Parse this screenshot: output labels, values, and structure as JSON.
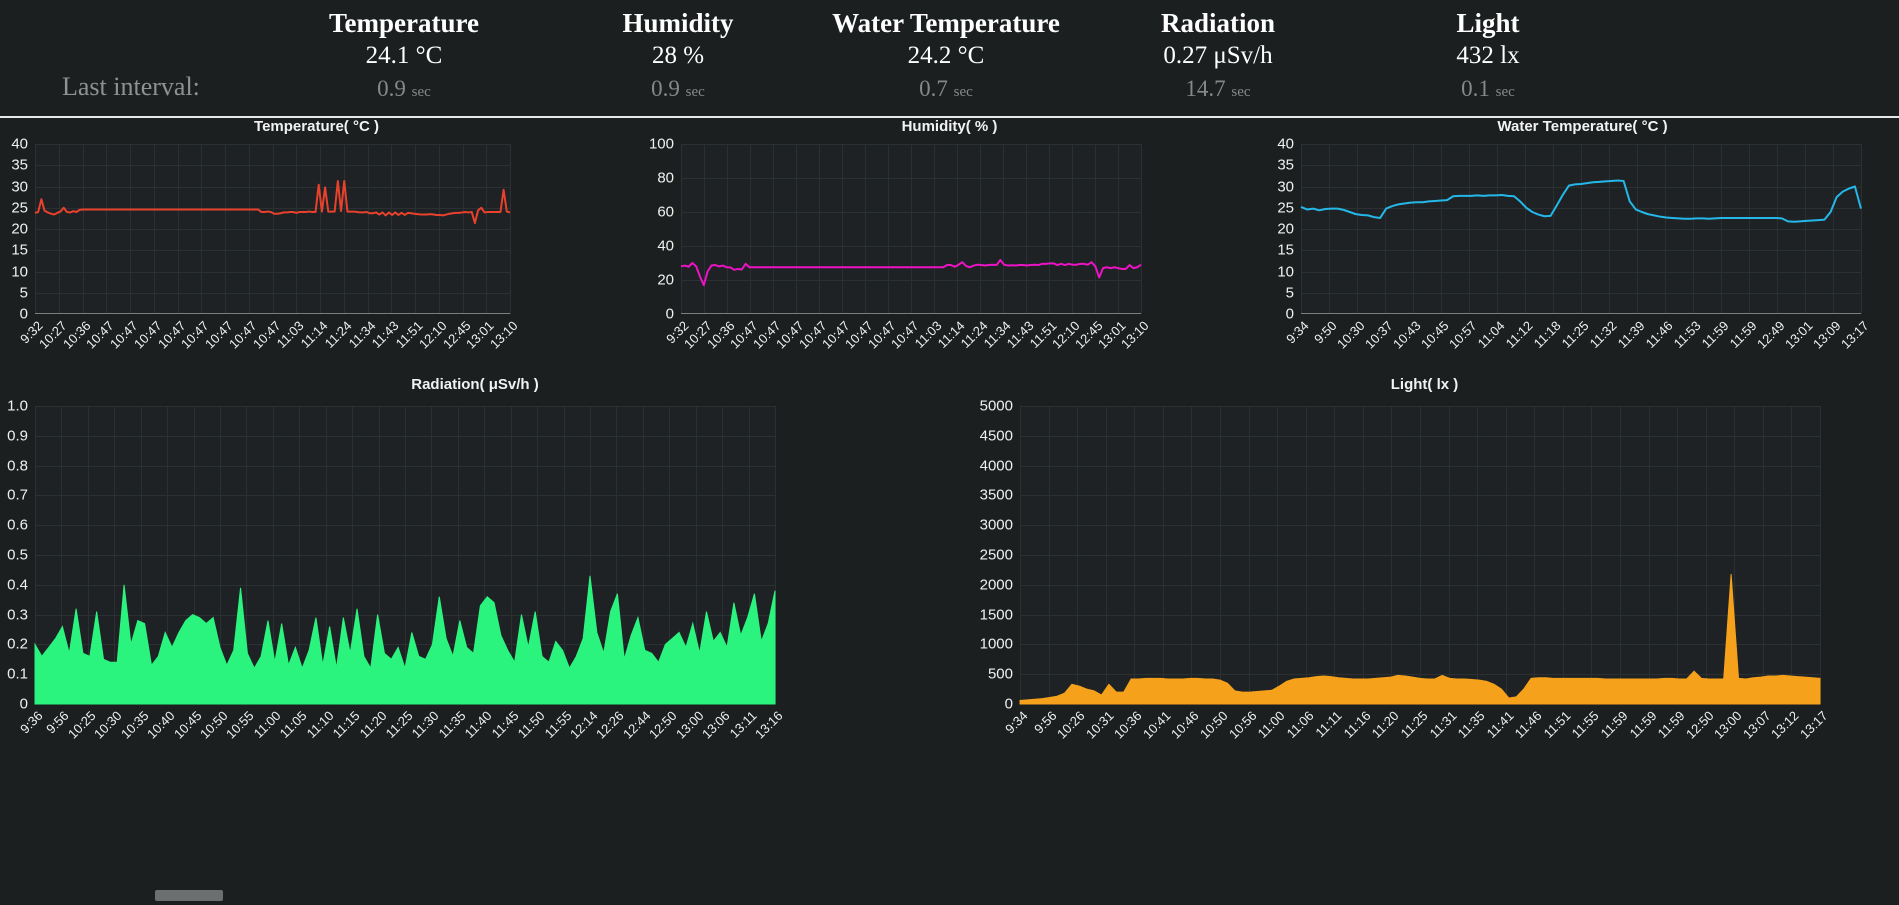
{
  "header": {
    "interval_label": "Last interval:",
    "metrics": [
      {
        "name": "Temperature",
        "value": "24.1 °C",
        "interval": "0.9",
        "interval_unit": "sec"
      },
      {
        "name": "Humidity",
        "value": "28 %",
        "interval": "0.9",
        "interval_unit": "sec"
      },
      {
        "name": "Water Temperature",
        "value": "24.2 °C",
        "interval": "0.7",
        "interval_unit": "sec"
      },
      {
        "name": "Radiation",
        "value": "0.27 μSv/h",
        "interval": "14.7",
        "interval_unit": "sec"
      },
      {
        "name": "Light",
        "value": "432 lx",
        "interval": "0.1",
        "interval_unit": "sec"
      }
    ]
  },
  "colors": {
    "background": "#1b1f20",
    "plot_background": "#1e2224",
    "grid": "#2b3133",
    "axis": "#7a8082",
    "text": "#f0f0f0",
    "muted_text": "#86898a",
    "temperature": "#e8412c",
    "humidity": "#ec13c4",
    "water_temperature": "#25b7e8",
    "radiation": "#2bf47e",
    "light": "#f5a11b"
  },
  "chart_data": [
    {
      "id": "temperature",
      "type": "line",
      "title": "Temperature( °C )",
      "xlabel": "",
      "ylabel": "°C",
      "ylim": [
        0,
        40
      ],
      "yticks": [
        40,
        35,
        30,
        25,
        20,
        15,
        10,
        5,
        0
      ],
      "grid": true,
      "color": "#e8412c",
      "x": [
        "9:32",
        "10:27",
        "10:36",
        "10:47",
        "10:47",
        "10:47",
        "10:47",
        "10:47",
        "10:47",
        "10:47",
        "10:47",
        "11:03",
        "11:14",
        "11:24",
        "11:34",
        "11:43",
        "11:51",
        "12:10",
        "12:45",
        "13:01",
        "13:10"
      ],
      "values": [
        23.8,
        24.0,
        27.0,
        24.3,
        23.9,
        23.6,
        23.4,
        23.8,
        24.1,
        25.0,
        24.0,
        23.9,
        24.2,
        24.0,
        24.5,
        24.6,
        24.6,
        24.6,
        24.6,
        24.6,
        24.6,
        24.6,
        24.6,
        24.6,
        24.6,
        24.6,
        24.6,
        24.6,
        24.6,
        24.6,
        24.6,
        24.6,
        24.6,
        24.6,
        24.6,
        24.6,
        24.6,
        24.6,
        24.6,
        24.6,
        24.6,
        24.6,
        24.6,
        24.6,
        24.6,
        24.6,
        24.6,
        24.6,
        24.6,
        24.6,
        24.6,
        24.6,
        24.6,
        24.6,
        24.6,
        24.6,
        24.6,
        24.6,
        24.6,
        24.6,
        24.6,
        24.6,
        24.6,
        24.6,
        24.6,
        24.6,
        24.6,
        24.6,
        24.6,
        24.6,
        24.6,
        24.0,
        24.0,
        24.1,
        24.0,
        23.6,
        23.6,
        23.7,
        23.9,
        23.9,
        24.0,
        24.0,
        23.8,
        24.0,
        24.0,
        24.0,
        24.1,
        24.0,
        24.0,
        30.4,
        24.1,
        29.8,
        24.1,
        24.1,
        24.1,
        31.3,
        24.2,
        31.3,
        24.1,
        24.1,
        24.1,
        24.0,
        23.9,
        23.9,
        24.0,
        23.7,
        23.7,
        23.9,
        23.4,
        23.9,
        23.2,
        23.9,
        23.3,
        23.9,
        23.3,
        23.8,
        23.3,
        23.8,
        23.7,
        23.6,
        23.5,
        23.4,
        23.4,
        23.4,
        23.5,
        23.4,
        23.3,
        23.3,
        23.2,
        23.4,
        23.6,
        23.7,
        23.8,
        23.8,
        23.9,
        24.0,
        23.9,
        24.0,
        21.4,
        24.4,
        25.0,
        23.9,
        24.0,
        24.0,
        24.0,
        24.0,
        24.0,
        29.2,
        24.1,
        23.9
      ]
    },
    {
      "id": "humidity",
      "type": "line",
      "title": "Humidity( % )",
      "xlabel": "",
      "ylabel": "%",
      "ylim": [
        0,
        100
      ],
      "yticks": [
        100,
        80,
        60,
        40,
        20,
        0
      ],
      "grid": true,
      "color": "#ec13c4",
      "x": [
        "9:32",
        "10:27",
        "10:36",
        "10:47",
        "10:47",
        "10:47",
        "10:47",
        "10:47",
        "10:47",
        "10:47",
        "10:47",
        "11:03",
        "11:14",
        "11:24",
        "11:34",
        "11:43",
        "11:51",
        "12:10",
        "12:45",
        "13:01",
        "13:10"
      ],
      "values": [
        28.0,
        28.5,
        27.8,
        30.0,
        28.0,
        22.0,
        17.0,
        25.0,
        28.5,
        28.8,
        28.0,
        28.5,
        27.5,
        27.4,
        26.0,
        26.5,
        26.2,
        29.5,
        27.5,
        27.5,
        27.5,
        27.5,
        27.5,
        27.5,
        27.5,
        27.5,
        27.5,
        27.5,
        27.5,
        27.5,
        27.5,
        27.5,
        27.5,
        27.5,
        27.5,
        27.5,
        27.5,
        27.5,
        27.5,
        27.5,
        27.5,
        27.5,
        27.5,
        27.5,
        27.5,
        27.5,
        27.5,
        27.5,
        27.5,
        27.5,
        27.5,
        27.5,
        27.5,
        27.5,
        27.5,
        27.5,
        27.5,
        27.5,
        27.5,
        27.5,
        27.5,
        27.5,
        27.5,
        27.5,
        27.5,
        27.5,
        27.5,
        27.5,
        27.5,
        27.5,
        28.8,
        28.8,
        27.8,
        29.0,
        30.5,
        28.2,
        27.5,
        28.5,
        29.0,
        28.8,
        28.5,
        28.8,
        29.0,
        28.8,
        31.8,
        29.0,
        28.5,
        28.7,
        28.5,
        28.8,
        28.8,
        28.5,
        28.8,
        29.0,
        28.8,
        29.5,
        29.5,
        29.8,
        29.8,
        28.8,
        29.5,
        28.8,
        29.5,
        29.0,
        29.0,
        29.5,
        29.5,
        29.0,
        30.5,
        28.0,
        21.5,
        27.0,
        27.5,
        27.0,
        27.5,
        27.0,
        26.5,
        26.5,
        28.8,
        27.0,
        27.5,
        29.0
      ]
    },
    {
      "id": "water_temperature",
      "type": "line",
      "title": "Water Temperature( °C )",
      "xlabel": "",
      "ylabel": "°C",
      "ylim": [
        0,
        40
      ],
      "yticks": [
        40,
        35,
        30,
        25,
        20,
        15,
        10,
        5,
        0
      ],
      "grid": true,
      "color": "#25b7e8",
      "x": [
        "9:34",
        "9:50",
        "10:30",
        "10:37",
        "10:43",
        "10:45",
        "10:57",
        "11:04",
        "11:12",
        "11:18",
        "11:25",
        "11:32",
        "11:39",
        "11:46",
        "11:53",
        "11:59",
        "11:59",
        "12:49",
        "13:01",
        "13:09",
        "13:17"
      ],
      "values": [
        25.2,
        24.6,
        24.8,
        24.4,
        24.7,
        24.8,
        24.8,
        24.5,
        24.0,
        23.5,
        23.3,
        23.2,
        22.8,
        22.6,
        24.8,
        25.4,
        25.8,
        26.0,
        26.2,
        26.3,
        26.3,
        26.5,
        26.6,
        26.7,
        26.8,
        27.7,
        27.8,
        27.8,
        27.8,
        27.9,
        27.8,
        27.9,
        27.9,
        28.0,
        27.8,
        27.7,
        26.5,
        25.0,
        24.0,
        23.4,
        23.0,
        23.1,
        25.5,
        28.0,
        30.2,
        30.5,
        30.6,
        30.8,
        31.0,
        31.1,
        31.2,
        31.3,
        31.4,
        31.3,
        26.5,
        24.6,
        24.0,
        23.5,
        23.2,
        22.9,
        22.7,
        22.6,
        22.5,
        22.4,
        22.4,
        22.5,
        22.5,
        22.4,
        22.5,
        22.6,
        22.6,
        22.6,
        22.6,
        22.6,
        22.6,
        22.6,
        22.6,
        22.6,
        22.6,
        22.5,
        21.8,
        21.7,
        21.8,
        21.9,
        22.0,
        22.1,
        22.2,
        24.0,
        27.5,
        28.8,
        29.5,
        30.0,
        24.8
      ]
    },
    {
      "id": "radiation",
      "type": "area",
      "title": "Radiation( μSv/h )",
      "xlabel": "",
      "ylabel": "μSv/h",
      "ylim": [
        0,
        1.0
      ],
      "yticks": [
        "1.0",
        "0.9",
        "0.8",
        "0.7",
        "0.6",
        "0.5",
        "0.4",
        "0.3",
        "0.2",
        "0.1",
        "0"
      ],
      "grid": true,
      "color": "#2bf47e",
      "x": [
        "9:36",
        "9:56",
        "10:25",
        "10:30",
        "10:35",
        "10:40",
        "10:45",
        "10:50",
        "10:55",
        "11:00",
        "11:05",
        "11:10",
        "11:15",
        "11:20",
        "11:25",
        "11:30",
        "11:35",
        "11:40",
        "11:45",
        "11:50",
        "11:55",
        "12:14",
        "12:26",
        "12:44",
        "12:50",
        "13:00",
        "13:06",
        "13:11",
        "13:16"
      ],
      "values": [
        0.2,
        0.16,
        0.19,
        0.22,
        0.26,
        0.17,
        0.32,
        0.17,
        0.16,
        0.31,
        0.15,
        0.14,
        0.14,
        0.4,
        0.2,
        0.28,
        0.27,
        0.13,
        0.16,
        0.24,
        0.19,
        0.24,
        0.28,
        0.3,
        0.29,
        0.27,
        0.29,
        0.19,
        0.13,
        0.18,
        0.39,
        0.17,
        0.12,
        0.16,
        0.28,
        0.14,
        0.27,
        0.13,
        0.19,
        0.12,
        0.18,
        0.29,
        0.13,
        0.26,
        0.12,
        0.29,
        0.17,
        0.32,
        0.16,
        0.12,
        0.3,
        0.17,
        0.15,
        0.19,
        0.12,
        0.24,
        0.16,
        0.15,
        0.2,
        0.36,
        0.22,
        0.16,
        0.28,
        0.19,
        0.17,
        0.33,
        0.36,
        0.34,
        0.23,
        0.18,
        0.14,
        0.3,
        0.19,
        0.31,
        0.16,
        0.14,
        0.21,
        0.18,
        0.12,
        0.16,
        0.22,
        0.43,
        0.24,
        0.17,
        0.31,
        0.37,
        0.15,
        0.23,
        0.29,
        0.18,
        0.17,
        0.14,
        0.2,
        0.22,
        0.24,
        0.19,
        0.27,
        0.17,
        0.31,
        0.21,
        0.24,
        0.19,
        0.34,
        0.23,
        0.29,
        0.37,
        0.21,
        0.27,
        0.38
      ]
    },
    {
      "id": "light",
      "type": "area",
      "title": "Light( lx )",
      "xlabel": "",
      "ylabel": "lx",
      "ylim": [
        0,
        5000
      ],
      "yticks": [
        5000,
        4500,
        4000,
        3500,
        3000,
        2500,
        2000,
        1500,
        1000,
        500,
        0
      ],
      "grid": true,
      "color": "#f5a11b",
      "x": [
        "9:34",
        "9:56",
        "10:26",
        "10:31",
        "10:36",
        "10:41",
        "10:46",
        "10:50",
        "10:56",
        "11:00",
        "11:06",
        "11:11",
        "11:16",
        "11:20",
        "11:25",
        "11:31",
        "11:35",
        "11:41",
        "11:46",
        "11:51",
        "11:55",
        "11:59",
        "11:59",
        "11:59",
        "12:50",
        "13:00",
        "13:07",
        "13:12",
        "13:17"
      ],
      "values": [
        60,
        70,
        80,
        90,
        110,
        130,
        180,
        330,
        300,
        250,
        220,
        150,
        330,
        200,
        200,
        420,
        420,
        430,
        430,
        430,
        420,
        420,
        420,
        430,
        430,
        420,
        420,
        400,
        350,
        220,
        200,
        200,
        210,
        220,
        230,
        300,
        380,
        420,
        430,
        440,
        460,
        470,
        460,
        440,
        430,
        420,
        420,
        420,
        430,
        440,
        450,
        480,
        470,
        450,
        430,
        420,
        420,
        480,
        430,
        420,
        420,
        410,
        400,
        380,
        330,
        250,
        100,
        120,
        250,
        430,
        440,
        440,
        430,
        430,
        430,
        430,
        430,
        430,
        430,
        420,
        420,
        420,
        420,
        420,
        420,
        420,
        420,
        430,
        430,
        420,
        420,
        550,
        430,
        420,
        420,
        420,
        2180,
        430,
        420,
        440,
        450,
        470,
        470,
        480,
        470,
        460,
        450,
        440,
        430
      ]
    }
  ],
  "scrollbar": {
    "present": true
  }
}
